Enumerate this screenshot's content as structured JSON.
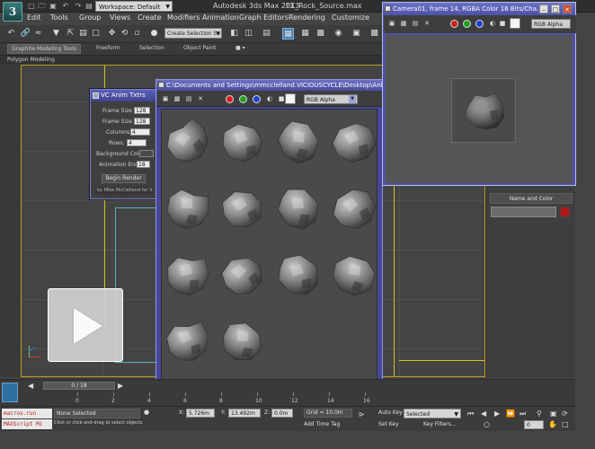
{
  "titlebar": {
    "workspace": "Workspace: Default",
    "app_name": "Autodesk 3ds Max 2013",
    "file_name": "FX_Rock_Source.max"
  },
  "menu": [
    "Edit",
    "Tools",
    "Group",
    "Views",
    "Create",
    "Modifiers",
    "Animation",
    "Graph Editors",
    "Rendering",
    "Customize"
  ],
  "toolbar": {
    "selection_set": "Create Selection Se"
  },
  "ribbon": {
    "tabs": [
      "Graphite Modeling Tools",
      "Freeform",
      "Selection",
      "Object Paint"
    ],
    "active_tab": "Graphite Modeling Tools",
    "panel": "Polygon Modeling"
  },
  "anim_window": {
    "title": "VC Anim Txtrs",
    "frame_size_x_label": "Frame Size X:",
    "frame_size_x": "128",
    "frame_size_y_label": "Frame Size Y:",
    "frame_size_y": "128",
    "columns_label": "Columns:",
    "columns": "4",
    "rows_label": "Rows:",
    "rows": "4",
    "background_color_label": "Background Color:",
    "animation_end_label": "Animation End:",
    "animation_end": "18",
    "begin_render": "Begin Render",
    "credit": "by Mike McClelland for VI"
  },
  "frame_window": {
    "title": "C:\\Documents and Settings\\mmcclelland.VICIOUSCYCLE\\Desktop\\Ani",
    "channel": "RGB Alpha",
    "rock_count": 14
  },
  "camera_window": {
    "title": "Camera01, frame 14, RGBA Color 16 Bits/Cha...",
    "channel": "RGB Alpha"
  },
  "right_panel": {
    "section": "Name and Color",
    "swatch_color": "#b01818"
  },
  "timeline": {
    "slider": "0 / 18",
    "ticks": [
      "0",
      "2",
      "4",
      "6",
      "8",
      "10",
      "12",
      "14",
      "16"
    ]
  },
  "status": {
    "macros": "macros.run",
    "maxscript": "MAXScript Mi",
    "selection": "None Selected",
    "prompt": "Click or click-and-drag to select objects",
    "x_label": "X:",
    "x": "5.726m",
    "y_label": "Y:",
    "y": "13.492m",
    "z_label": "Z:",
    "z": "0.0m",
    "grid": "Grid = 10.0m",
    "add_time_tag": "Add Time Tag",
    "auto_key": "Auto Key",
    "set_key": "Set Key",
    "selected": "Selected",
    "key_filters": "Key Filters...",
    "frame": "0"
  },
  "colors": {
    "window_title_blue": "#5a61b8",
    "viewport_border": "#bd9f1a",
    "swatch_red": "#b01818",
    "accent_teal": "#2d6f9f"
  }
}
